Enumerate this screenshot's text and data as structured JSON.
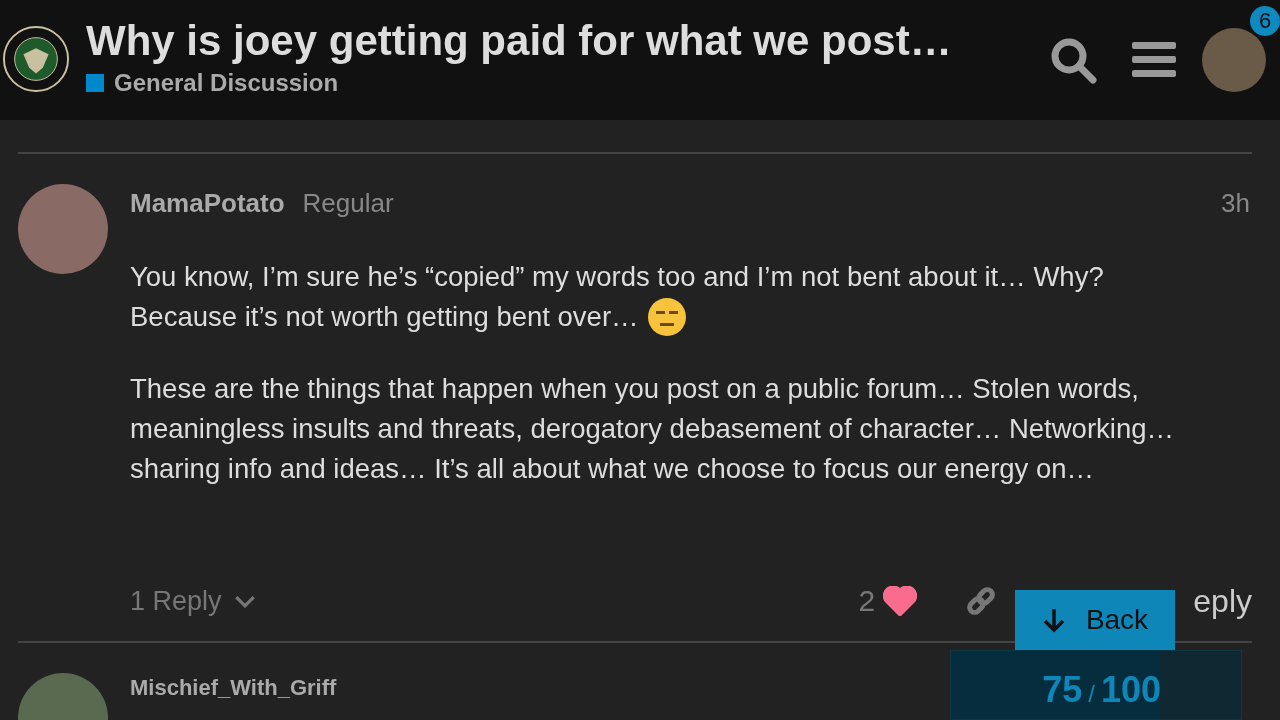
{
  "header": {
    "title": "Why is joey getting paid for what we post…",
    "category": {
      "name": "General Discussion",
      "color": "#0088cc"
    },
    "notification_count": "6"
  },
  "post": {
    "username": "MamaPotato",
    "title": "Regular",
    "age": "3h",
    "paragraphs": [
      {
        "lines": [
          {
            "text": "You know, I’m sure he’s “copied” my words too and I’m not bent about it… Why?",
            "emoji": false
          },
          {
            "text": "Because it’s not worth getting bent over…",
            "emoji": true
          }
        ]
      },
      {
        "lines": [
          {
            "text": "These are the things that happen when you post on a public forum… Stolen words, meaningless insults and threats, derogatory debasement of character… Networking… sharing info and ideas… It’s all about what we choose to focus our energy on…",
            "emoji": false
          }
        ]
      }
    ],
    "replies": "1 Reply",
    "likes": "2",
    "liked": true,
    "reply_label": "eply"
  },
  "back_button": "Back",
  "timeline": {
    "current": "75",
    "separator": "/",
    "total": "100",
    "level": 0.72
  },
  "next_post": {
    "username": "Mischief_With_Griff"
  }
}
